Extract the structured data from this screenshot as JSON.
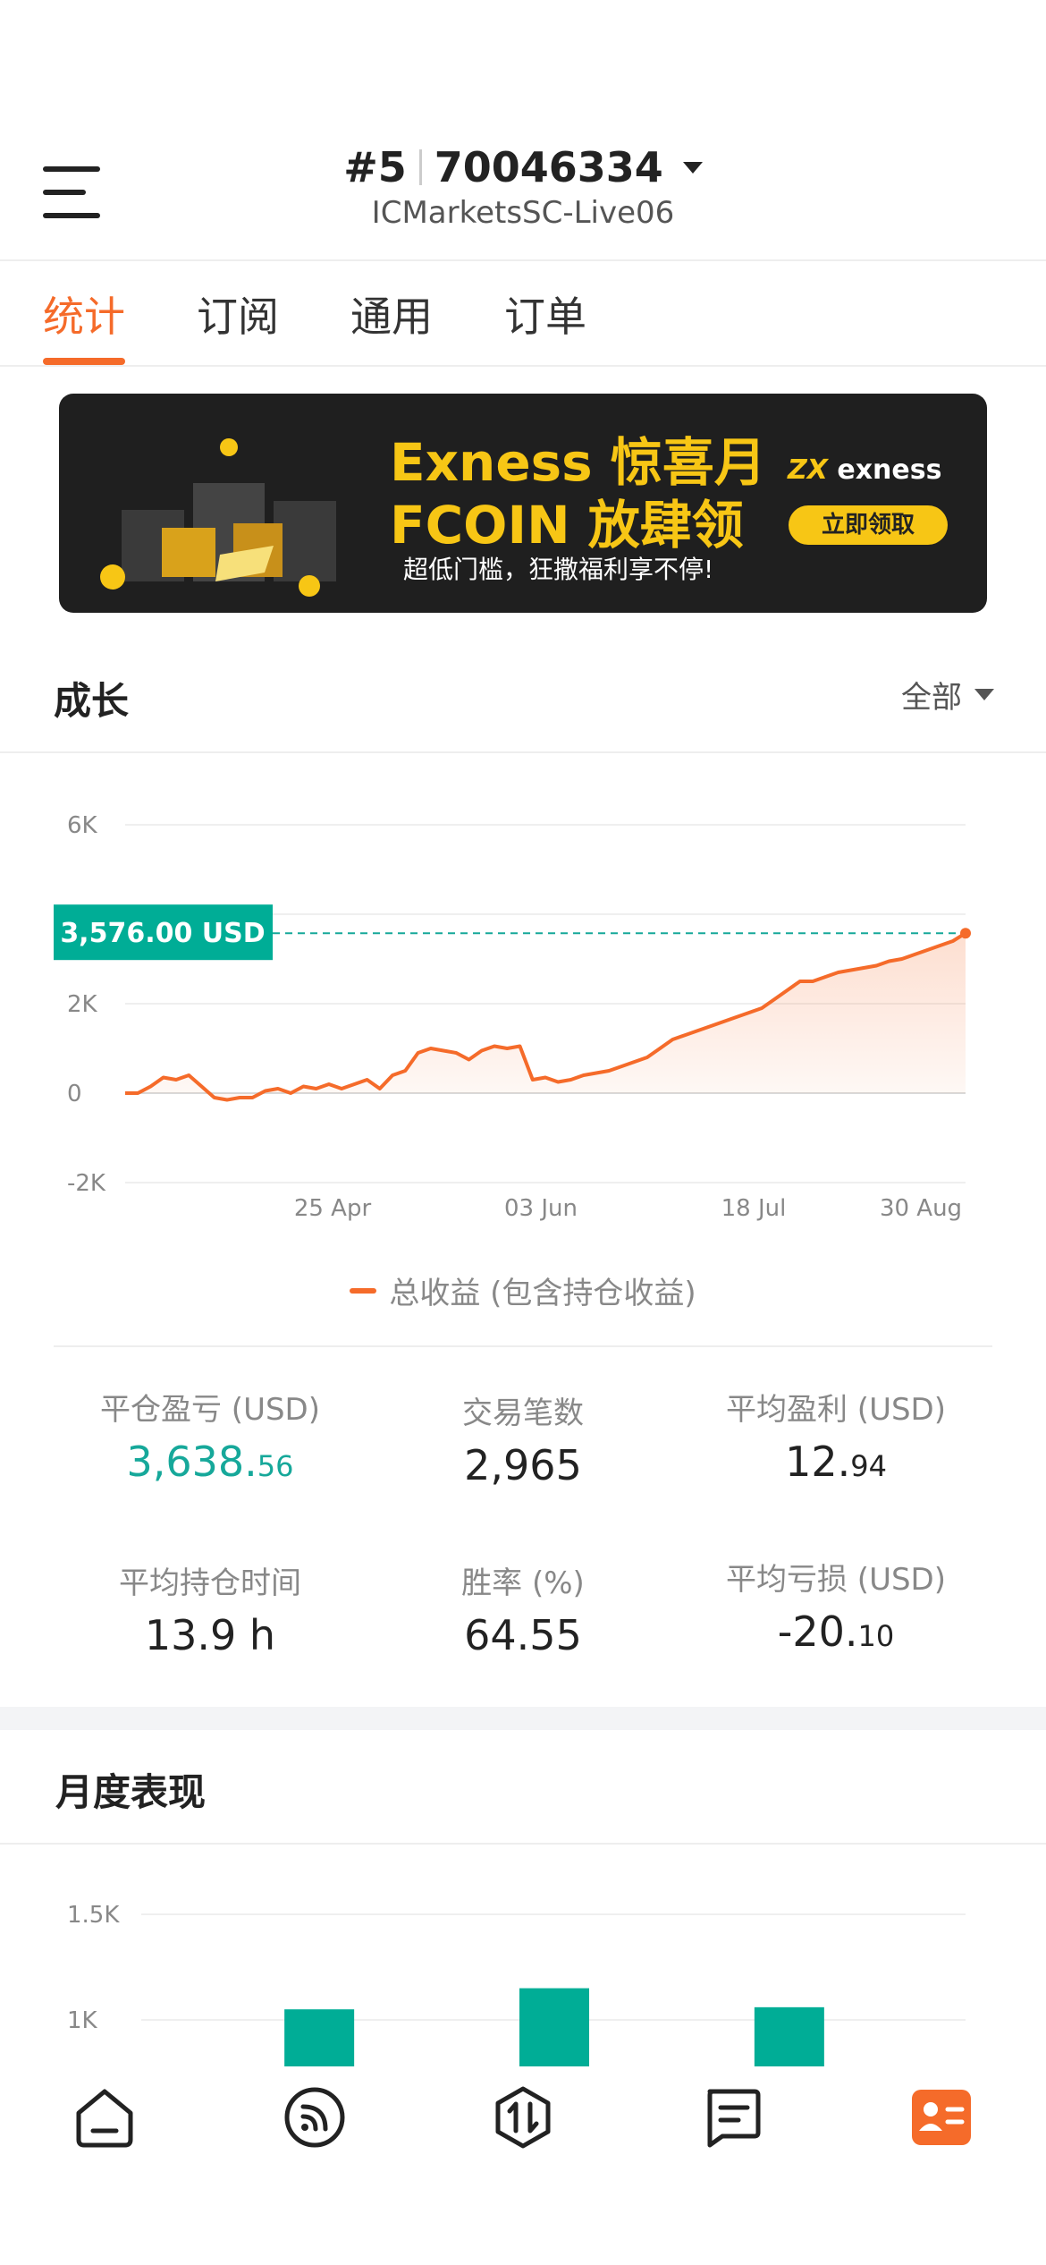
{
  "header": {
    "account_index": "#5",
    "account_number": "70046334",
    "server": "ICMarketsSC-Live06"
  },
  "tabs": [
    {
      "label": "统计",
      "active": true
    },
    {
      "label": "订阅",
      "active": false
    },
    {
      "label": "通用",
      "active": false
    },
    {
      "label": "订单",
      "active": false
    }
  ],
  "banner": {
    "line1": "Exness 惊喜月",
    "line2": "FCOIN 放肆领",
    "subtitle": "超低门槛，狂撒福利享不停!",
    "logo": "exness",
    "button": "立即领取"
  },
  "growth": {
    "title": "成长",
    "filter": "全部",
    "legend": "总收益 (包含持仓收益)"
  },
  "chart_data": [
    {
      "type": "area",
      "title": "成长",
      "y_ticks": [
        "6K",
        "4K",
        "2K",
        "0",
        "-2K"
      ],
      "ylim": [
        -2000,
        6000
      ],
      "x_ticks": [
        "25 Apr",
        "03 Jun",
        "18 Jul",
        "30 Aug"
      ],
      "current_label": "3,576.00 USD",
      "current_value": 3576,
      "series": [
        {
          "name": "总收益 (包含持仓收益)",
          "color": "#f56b2a",
          "values": [
            0,
            0,
            150,
            350,
            300,
            400,
            150,
            -100,
            -150,
            -100,
            -100,
            50,
            100,
            0,
            150,
            100,
            200,
            100,
            200,
            300,
            100,
            400,
            500,
            900,
            1000,
            950,
            900,
            750,
            950,
            1050,
            1000,
            1050,
            300,
            350,
            250,
            300,
            400,
            450,
            500,
            600,
            700,
            800,
            1000,
            1200,
            1300,
            1400,
            1500,
            1600,
            1700,
            1800,
            1900,
            2100,
            2300,
            2500,
            2500,
            2600,
            2700,
            2750,
            2800,
            2850,
            2950,
            3000,
            3100,
            3200,
            3300,
            3400,
            3576
          ]
        }
      ]
    },
    {
      "type": "bar",
      "title": "月度表现",
      "y_ticks": [
        "1.5K",
        "1K"
      ],
      "ylim": [
        700,
        1500
      ],
      "categories": [
        "",
        "",
        "",
        "",
        "",
        "",
        ""
      ],
      "series": [
        {
          "name": "",
          "values": [
            null,
            1050,
            null,
            1150,
            null,
            1060,
            null
          ],
          "color": "#00ad96"
        }
      ]
    }
  ],
  "stats": [
    {
      "label": "平仓盈亏 (USD)",
      "int": "3,638.",
      "dec": "56",
      "green": true
    },
    {
      "label": "交易笔数",
      "int": "2,965",
      "dec": "",
      "green": false
    },
    {
      "label": "平均盈利 (USD)",
      "int": "12.",
      "dec": "94",
      "green": false
    },
    {
      "label": "平均持仓时间",
      "int": "13.9 h",
      "dec": "",
      "green": false
    },
    {
      "label": "胜率 (%)",
      "int": "64.55",
      "dec": "",
      "green": false
    },
    {
      "label": "平均亏损 (USD)",
      "int": "-20.",
      "dec": "10",
      "green": false
    }
  ],
  "monthly": {
    "title": "月度表现"
  },
  "nav": [
    "home-icon",
    "feed-icon",
    "trade-icon",
    "orders-icon",
    "account-icon"
  ],
  "colors": {
    "accent": "#f56b2a",
    "green": "#00ad96",
    "banner_yellow": "#f7c615"
  }
}
